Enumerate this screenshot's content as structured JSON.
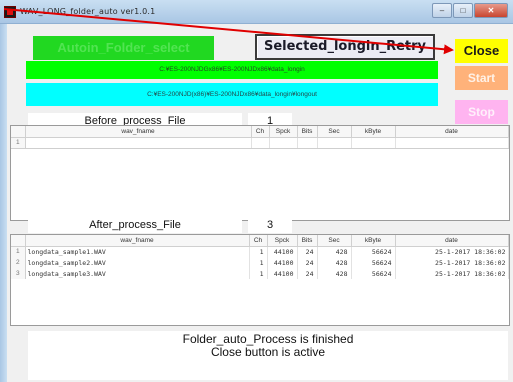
{
  "window": {
    "title": "WAV_LONG_folder_auto  ver1.0.1"
  },
  "buttons": {
    "autoin_folder": "Autoin_Folder_select",
    "selected_retry": "Selected_longin_Retry",
    "close": "Close",
    "start": "Start",
    "stop": "Stop"
  },
  "paths": {
    "input": "C:¥ES-200NJDGx86¥ES-200NJDx86¥data_longin",
    "output": "C:¥ES-200NJD(x86)¥ES-200NJDx86¥data_longin¥longout"
  },
  "before": {
    "label": "Before_process_File",
    "count": "1",
    "columns": [
      "",
      "wav_fname",
      "Ch",
      "Spck",
      "Bits",
      "Sec",
      "kByte",
      "date"
    ],
    "rows": [
      {
        "n": "1",
        "fname": "",
        "ch": "",
        "spck": "",
        "bits": "",
        "sec": "",
        "kbyte": "",
        "date": ""
      }
    ]
  },
  "after": {
    "label": "After_process_File",
    "count": "3",
    "columns": [
      "",
      "wav_fname",
      "Ch",
      "Spck",
      "Bits",
      "Sec",
      "kByte",
      "date"
    ],
    "rows": [
      {
        "n": "1",
        "fname": "longdata_sample1.WAV",
        "ch": "1",
        "spck": "44100",
        "bits": "24",
        "sec": "428",
        "kbyte": "56624",
        "date": "25-1-2017 18:36:02"
      },
      {
        "n": "2",
        "fname": "longdata_sample2.WAV",
        "ch": "1",
        "spck": "44100",
        "bits": "24",
        "sec": "428",
        "kbyte": "56624",
        "date": "25-1-2017 18:36:02"
      },
      {
        "n": "3",
        "fname": "longdata_sample3.WAV",
        "ch": "1",
        "spck": "44100",
        "bits": "24",
        "sec": "428",
        "kbyte": "56624",
        "date": "25-1-2017 18:36:02"
      }
    ]
  },
  "status": {
    "line1": "Folder_auto_Process is finished",
    "line2": "Close button is active"
  },
  "colors": {
    "green_button": "#21d821",
    "green_bar": "#00ff00",
    "cyan_bar": "#00ffff",
    "close": "#ffff00",
    "start": "#ffb27a",
    "stop": "#ffb4f0",
    "annotation_arrow": "#e00000"
  },
  "icons": {
    "app": "app-icon",
    "annotation": "red-arrow-icon"
  }
}
